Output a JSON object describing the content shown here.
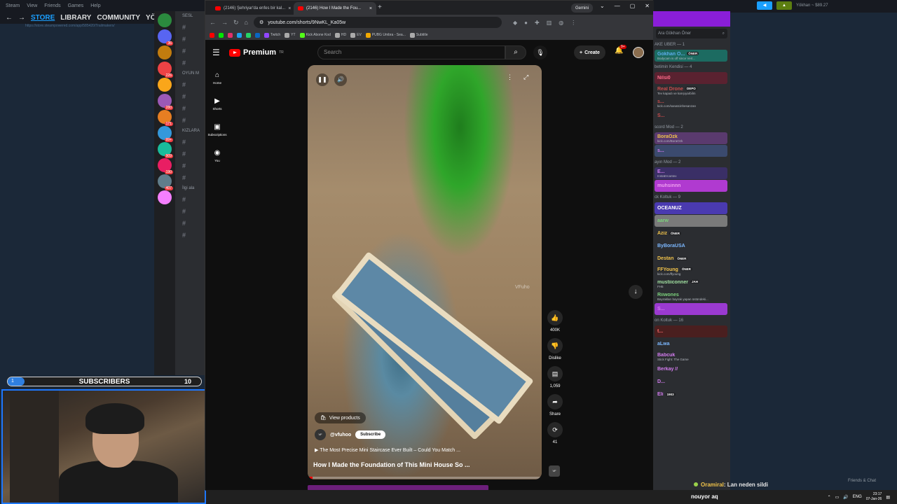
{
  "steam": {
    "menu": [
      "Steam",
      "View",
      "Friends",
      "Games",
      "Help"
    ],
    "nav": {
      "store": "STORE",
      "library": "LIBRARY",
      "community": "COMMUNITY",
      "user": "YÖKHA"
    },
    "url": "https://store.steampowered.com/app/585420/Trailmakers/",
    "account": "Yökhan ~ $89.27",
    "friends_chat": "Friends & Chat"
  },
  "discord": {
    "servers": [
      {
        "badge": "",
        "color": "#2b8a3e"
      },
      {
        "badge": "36",
        "color": "#5865f2"
      },
      {
        "badge": "",
        "color": "#c27c0e"
      },
      {
        "badge": "226",
        "color": "#ed4245"
      },
      {
        "badge": "",
        "color": "#faa61a"
      },
      {
        "badge": "280",
        "color": "#9b59b6"
      },
      {
        "badge": "171",
        "color": "#e67e22"
      },
      {
        "badge": "99+",
        "color": "#3498db"
      },
      {
        "badge": "909",
        "color": "#1abc9c"
      },
      {
        "badge": "190",
        "color": "#e91e63"
      },
      {
        "badge": "407",
        "color": "#607d8b"
      },
      {
        "badge": "",
        "color": "#f47fff"
      }
    ],
    "channel_categories": [
      "SESL",
      "OYUN M",
      "KIZLARA",
      "İlgi ala"
    ],
    "member_search": "Ara Gökhan Öner",
    "groups": [
      {
        "title": "AKE UBER — 1",
        "members": [
          {
            "name": "Gokhan O...",
            "tag": "ÖNER",
            "status": "Bodycam is off since Vert...",
            "color": "#5dadec",
            "bg": "#1c6b61"
          }
        ]
      },
      {
        "title": "betimin Kendisi — 4",
        "members": [
          {
            "name": "Nilsi0",
            "tag": "",
            "status": "",
            "color": "#ff6b8a",
            "bg": "#5a2230"
          },
          {
            "name": "Real Drone",
            "tag": "DEPO",
            "status": "Tev kapadı ve karışıyarbilm",
            "color": "#c94c4c",
            "bg": ""
          },
          {
            "name": "s...",
            "tag": "",
            "status": "kick.com/sanatcinhesanzan",
            "color": "#c94c4c",
            "bg": ""
          },
          {
            "name": "S...",
            "tag": "",
            "status": "",
            "color": "#c94c4c",
            "bg": ""
          }
        ]
      },
      {
        "title": "scord Mod — 2",
        "members": [
          {
            "name": "BoraOzk",
            "tag": "",
            "status": "kick.com/BoraOzk",
            "color": "#f0c24a",
            "bg": "#5a3a6e"
          },
          {
            "name": "s...",
            "tag": "",
            "status": "",
            "color": "#d47cf0",
            "bg": "#3b4a6e"
          }
        ]
      },
      {
        "title": "ayın Mod — 2",
        "members": [
          {
            "name": "E...",
            "tag": "",
            "status": "InstaErcantex",
            "color": "#d47cf0",
            "bg": "#3a2f66"
          },
          {
            "name": "muhsinnn",
            "tag": "",
            "status": "",
            "color": "#f0a0f0",
            "bg": "#b03ad0"
          }
        ]
      },
      {
        "title": "ck Koltuk — 9",
        "members": [
          {
            "name": "OCEANUZ",
            "tag": "",
            "status": "",
            "color": "#ffffff",
            "bg": "#4a3ab0"
          },
          {
            "name": "aarw",
            "tag": "",
            "status": "",
            "color": "#7cd17c",
            "bg": "#7a7a7a"
          },
          {
            "name": "Aziz",
            "tag": "ÖNER",
            "status": "",
            "color": "#f0c24a",
            "bg": ""
          },
          {
            "name": "ByBoraUSA",
            "tag": "",
            "status": "",
            "color": "#7cb8ff",
            "bg": ""
          },
          {
            "name": "Destan",
            "tag": "ÖNER",
            "status": "",
            "color": "#f0c24a",
            "bg": ""
          },
          {
            "name": "FFYoung",
            "tag": "ÖNER",
            "status": "kick.com/ffyoung",
            "color": "#f0c24a",
            "bg": ""
          },
          {
            "name": "mustiiconner",
            "tag": "JAH",
            "status": "FH5",
            "color": "#a0e0a0",
            "bg": ""
          },
          {
            "name": "Riiwones",
            "tag": "",
            "status": "Bayrakları bayrak yapan üstündeki...",
            "color": "#7cd17c",
            "bg": ""
          },
          {
            "name": "S...",
            "tag": "",
            "status": "",
            "color": "#d47cf0",
            "bg": "#9b3ad0"
          }
        ]
      },
      {
        "title": "on Koltuk — 16",
        "members": [
          {
            "name": "t...",
            "tag": "",
            "status": "",
            "color": "#ff6b6b",
            "bg": "#4a1f1f"
          },
          {
            "name": "aLwa",
            "tag": "",
            "status": "",
            "color": "#7cb8ff",
            "bg": ""
          },
          {
            "name": "Babcuk",
            "tag": "",
            "status": "Stick Fight: The Game",
            "color": "#d47cf0",
            "bg": ""
          },
          {
            "name": "Berkay //",
            "tag": "",
            "status": "",
            "color": "#d47cf0",
            "bg": ""
          },
          {
            "name": "D...",
            "tag": "",
            "status": "",
            "color": "#d47cf0",
            "bg": ""
          },
          {
            "name": "Eli",
            "tag": "1903",
            "status": "",
            "color": "#d47cf0",
            "bg": ""
          }
        ]
      }
    ]
  },
  "subscribers": {
    "label": "SUBSCRIBERS",
    "current": "1",
    "goal": "10",
    "progress": 0.1
  },
  "browser": {
    "tabs": [
      {
        "title": "(2146) Şehriyar'da enfes bir kal...",
        "active": false
      },
      {
        "title": "(2146) How I Made the Fou...",
        "active": true
      }
    ],
    "gemini": "Gemini",
    "url": "youtube.com/shorts/9NwKL_Ka05w",
    "bookmarks": [
      "Twitch",
      "YT",
      "Kick Abone Kod",
      "HD",
      "EV",
      "PUBG Umbra - Sea...",
      "Subtitle"
    ]
  },
  "youtube": {
    "logo": "Premium",
    "logo_sup": "TR",
    "search_placeholder": "Search",
    "create": "Create",
    "notifications": "9+",
    "sidebar": [
      {
        "icon": "home-icon",
        "glyph": "⌂",
        "label": "Home"
      },
      {
        "icon": "shorts-icon",
        "glyph": "▶",
        "label": "Shorts"
      },
      {
        "icon": "subscriptions-icon",
        "glyph": "▣",
        "label": "Subscriptions"
      },
      {
        "icon": "you-icon",
        "glyph": "◉",
        "label": "You"
      }
    ],
    "short": {
      "watermark": "VFuho",
      "view_products": "View products",
      "channel": "@vfuhoo",
      "subscribe": "Subscribe",
      "related": "▶ The Most Precise Mini Staircase Ever Built – Could You Match ...",
      "title": "How I Made the Foundation of This Mini House So ...",
      "progress": 0.02
    },
    "actions": [
      {
        "icon": "like-icon",
        "glyph": "👍",
        "label": "400K"
      },
      {
        "icon": "dislike-icon",
        "glyph": "👎",
        "label": "Dislike"
      },
      {
        "icon": "comment-icon",
        "glyph": "▤",
        "label": "1,059"
      },
      {
        "icon": "share-icon",
        "glyph": "➦",
        "label": "Share"
      },
      {
        "icon": "remix-icon",
        "glyph": "⟳",
        "label": "41"
      }
    ]
  },
  "chat": {
    "user": "Oramiral",
    "message": ": Lan neden sildi"
  },
  "taskbar": {
    "text": "nouyor aq",
    "lang": "ENG",
    "time": "23:17",
    "date": "07-Jan-26"
  }
}
